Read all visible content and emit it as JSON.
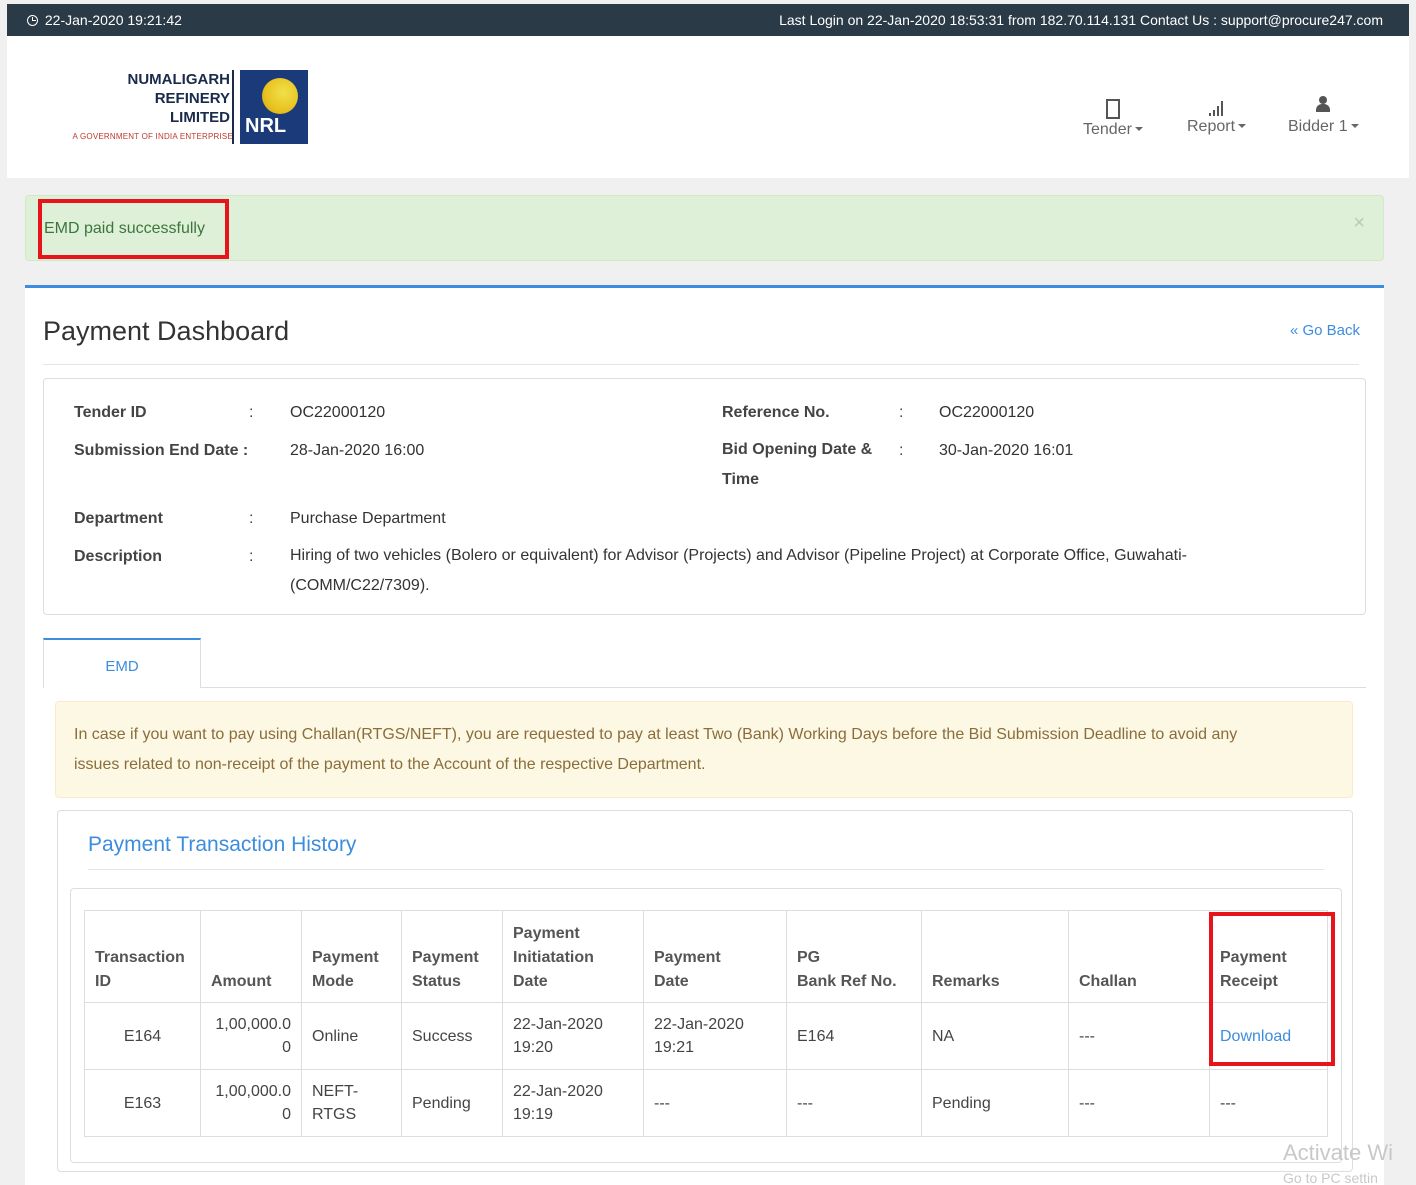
{
  "topbar": {
    "datetime": "22-Jan-2020 19:21:42",
    "login_info": "Last Login on 22-Jan-2020 18:53:31 from 182.70.114.131 Contact Us : support@procure247.com"
  },
  "logo": {
    "line1": "NUMALIGARH",
    "line2": "REFINERY",
    "line3": "LIMITED",
    "subtitle": "A GOVERNMENT OF INDIA ENTERPRISE",
    "mark": "NRL"
  },
  "nav": {
    "tender": "Tender",
    "report": "Report",
    "bidder": "Bidder 1"
  },
  "alert": {
    "message": "EMD paid successfully",
    "close": "×"
  },
  "page": {
    "title": "Payment Dashboard",
    "go_back": "« Go Back"
  },
  "tender_info": {
    "tender_id_label": "Tender ID",
    "tender_id": "OC22000120",
    "reference_label": "Reference No.",
    "reference": "OC22000120",
    "submission_label": "Submission End Date :",
    "submission": "28-Jan-2020 16:00",
    "bid_opening_label_1": "Bid Opening Date &",
    "bid_opening_label_2": "Time",
    "bid_opening": "30-Jan-2020 16:01",
    "department_label": "Department",
    "department": "Purchase Department",
    "description_label": "Description",
    "description_1": "Hiring of two vehicles (Bolero or equivalent) for Advisor (Projects) and Advisor (Pipeline Project) at Corporate Office, Guwahati-",
    "description_2": "(COMM/C22/7309).",
    "colon": ":"
  },
  "tabs": [
    {
      "label": "EMD"
    }
  ],
  "notice": {
    "line1": "In case if you want to pay using Challan(RTGS/NEFT), you are requested to pay at least Two (Bank) Working Days before the Bid Submission Deadline to avoid any",
    "line2": "issues related to non-receipt of the payment to the Account of the respective Department."
  },
  "history": {
    "title": "Payment Transaction History",
    "headers": [
      [
        "Transaction",
        "ID"
      ],
      [
        "Amount"
      ],
      [
        "Payment",
        "Mode"
      ],
      [
        "Payment",
        "Status"
      ],
      [
        "Payment",
        "Initiatation",
        "Date"
      ],
      [
        "Payment",
        "Date"
      ],
      [
        "PG",
        "Bank Ref No."
      ],
      [
        "Remarks"
      ],
      [
        "Challan"
      ],
      [
        "Payment",
        "Receipt"
      ]
    ],
    "rows": [
      {
        "transaction_id": "E164",
        "amount_1": "1,00,000.0",
        "amount_2": "0",
        "mode_1": "Online",
        "mode_2": "",
        "status": "Success",
        "init_date_1": "22-Jan-2020",
        "init_date_2": "19:20",
        "pay_date_1": "22-Jan-2020",
        "pay_date_2": "19:21",
        "pg_ref": "E164",
        "remarks": "NA",
        "challan": "---",
        "receipt": "Download"
      },
      {
        "transaction_id": "E163",
        "amount_1": "1,00,000.0",
        "amount_2": "0",
        "mode_1": "NEFT-",
        "mode_2": "RTGS",
        "status": "Pending",
        "init_date_1": "22-Jan-2020",
        "init_date_2": "19:19",
        "pay_date_1": "---",
        "pay_date_2": "",
        "pg_ref": "---",
        "remarks": "Pending",
        "challan": "---",
        "receipt": "---"
      }
    ]
  },
  "watermark": {
    "line1": "Activate Wi",
    "line2": "Go to PC settin"
  },
  "colors": {
    "topbar": "#2b3a47",
    "accent": "#3c8dde",
    "success_bg": "#dff0d8",
    "warning_bg": "#fcf8e3",
    "highlight": "#e8141b"
  }
}
